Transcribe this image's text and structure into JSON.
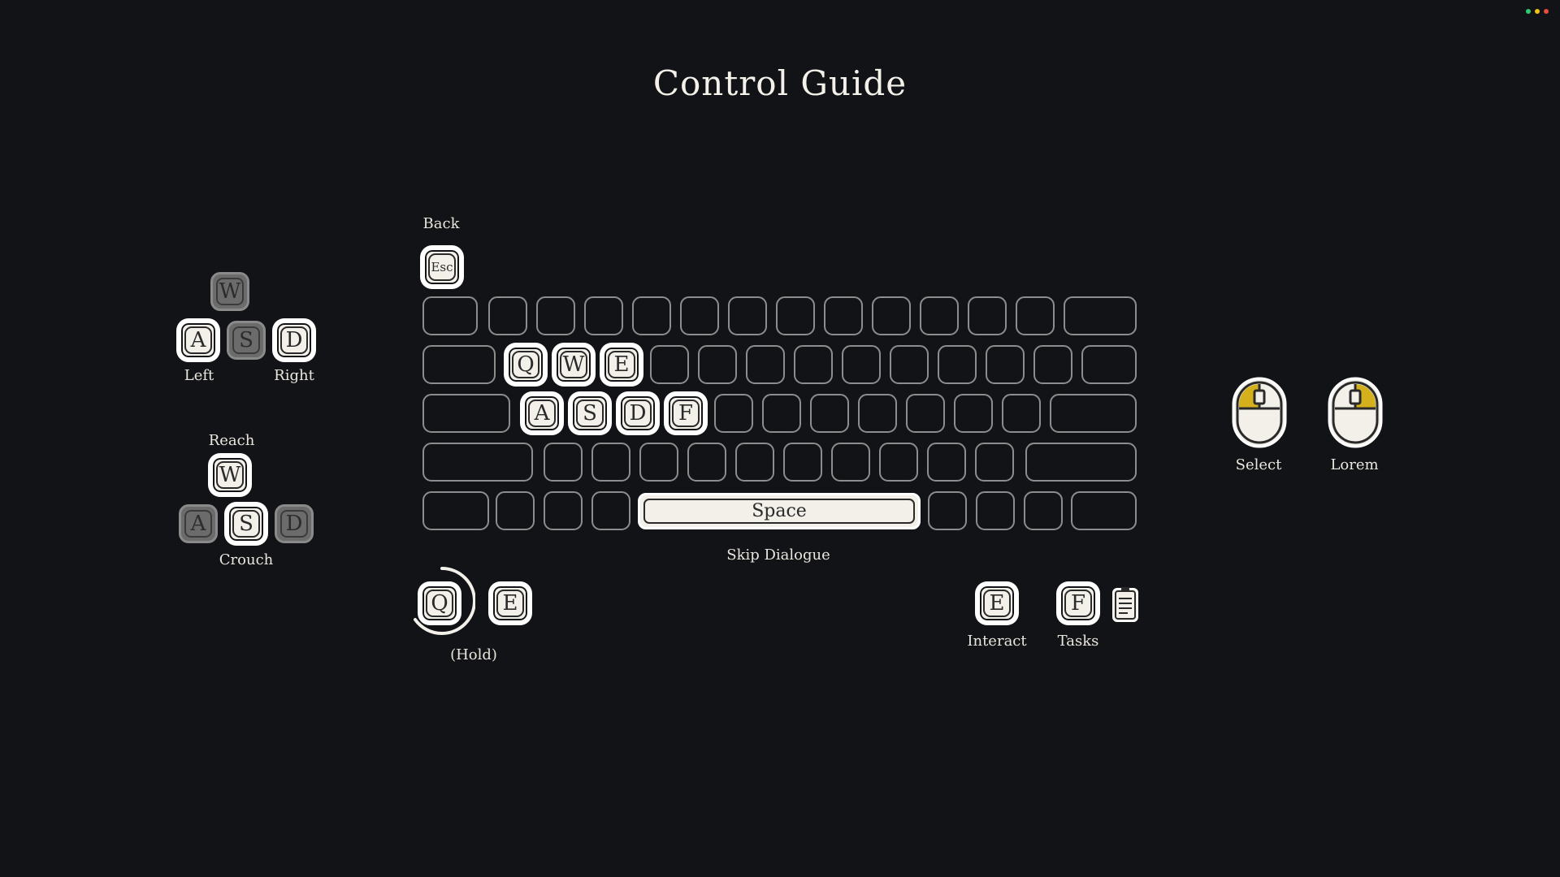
{
  "title": "Control Guide",
  "window_dots": [
    "#2ecc71",
    "#f1c40f",
    "#e74c3c"
  ],
  "movement": {
    "keys": [
      "W",
      "A",
      "S",
      "D"
    ],
    "left_label": "Left",
    "right_label": "Right"
  },
  "reach": {
    "title": "Reach",
    "keys": [
      "W",
      "A",
      "S",
      "D"
    ],
    "label": "Crouch"
  },
  "keyboard": {
    "back_label": "Back",
    "esc": "Esc",
    "row2_keys": [
      "Q",
      "W",
      "E"
    ],
    "row3_keys": [
      "A",
      "S",
      "D",
      "F"
    ],
    "space": "Space",
    "space_label": "Skip Dialogue"
  },
  "hold": {
    "q": "Q",
    "e": "E",
    "label": "(Hold)"
  },
  "interact": {
    "key": "E",
    "label": "Interact"
  },
  "tasks": {
    "key": "F",
    "label": "Tasks",
    "icon": "clipboard-icon"
  },
  "mouse": {
    "select_label": "Select",
    "lorem_label": "Lorem",
    "highlight": "#d4b01c"
  }
}
